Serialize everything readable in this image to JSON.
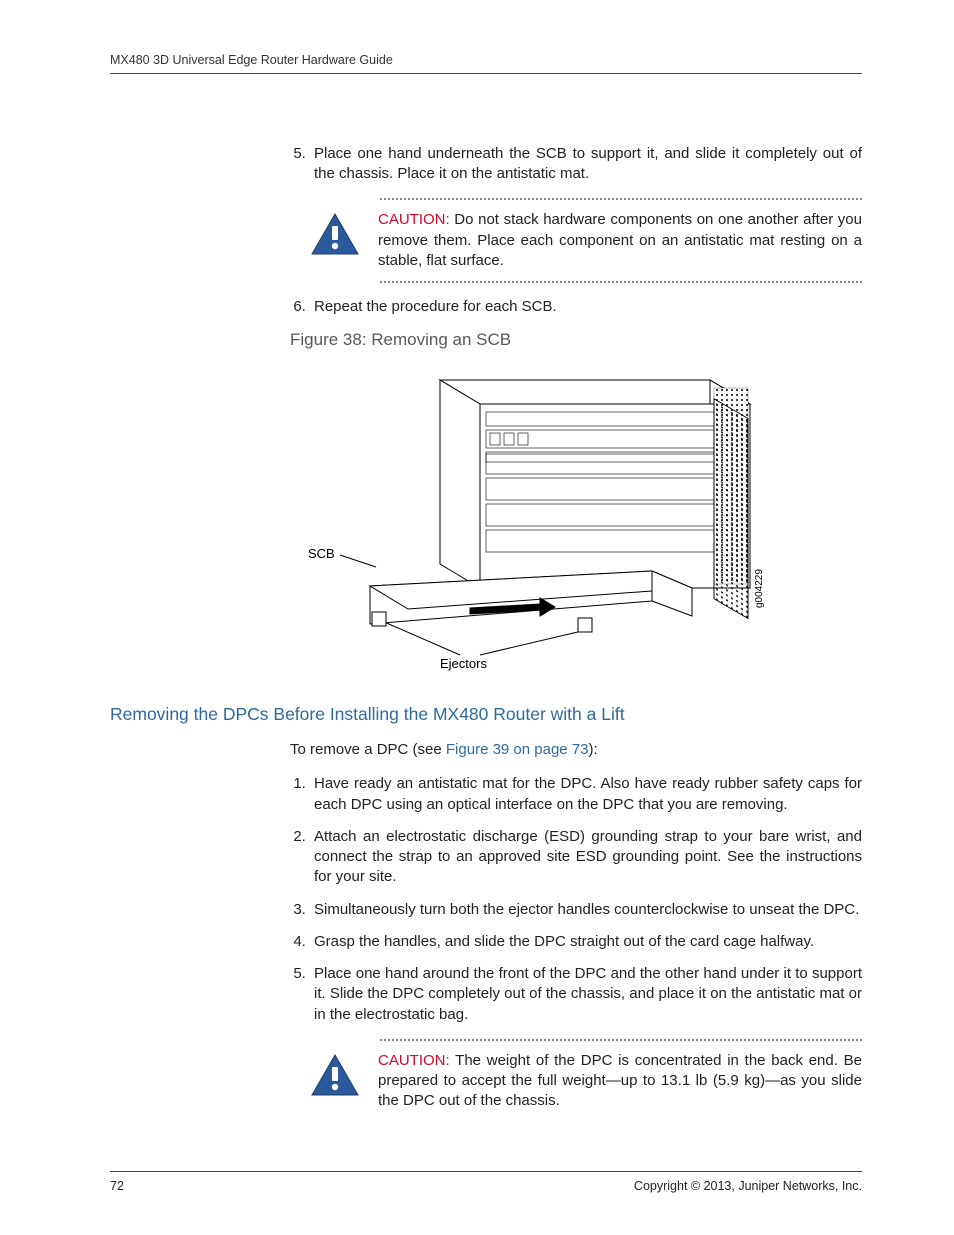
{
  "running_head": "MX480 3D Universal Edge Router Hardware Guide",
  "steps_a": {
    "start": 5,
    "items": [
      "Place one hand underneath the SCB to support it, and slide it completely out of the chassis. Place it on the antistatic mat."
    ]
  },
  "caution1": {
    "label": "CAUTION:",
    "text": " Do not stack hardware components on one another after you remove them. Place each component on an antistatic mat resting on a stable, flat surface."
  },
  "steps_b": {
    "start": 6,
    "items": [
      "Repeat the procedure for each SCB."
    ]
  },
  "figure_caption": "Figure 38: Removing an SCB",
  "figure_labels": {
    "scb": "SCB",
    "ejectors": "Ejectors",
    "code": "g004229"
  },
  "section_title": "Removing the DPCs Before Installing the MX480 Router with a Lift",
  "intro": {
    "pre": "To remove a DPC (see ",
    "link": "Figure 39 on page 73",
    "post": "):"
  },
  "steps_c": {
    "start": 1,
    "items": [
      "Have ready an antistatic mat for the DPC. Also have ready rubber safety caps for each DPC using an optical interface on the DPC that you are removing.",
      "Attach an electrostatic discharge (ESD) grounding strap to your bare wrist, and connect the strap to an approved site ESD grounding point. See the instructions for your site.",
      "Simultaneously turn both the ejector handles counterclockwise to unseat the DPC.",
      "Grasp the handles, and slide the DPC straight out of the card cage halfway.",
      "Place one hand around the front of the DPC and the other hand under it to support it. Slide the DPC completely out of the chassis, and place it on the antistatic mat or in the electrostatic bag."
    ]
  },
  "caution2": {
    "label": "CAUTION:",
    "text": " The weight of the DPC is concentrated in the back end. Be prepared to accept the full weight—up to 13.1 lb (5.9 kg)—as you slide the DPC out of the chassis."
  },
  "footer": {
    "page": "72",
    "copyright": "Copyright © 2013, Juniper Networks, Inc."
  }
}
